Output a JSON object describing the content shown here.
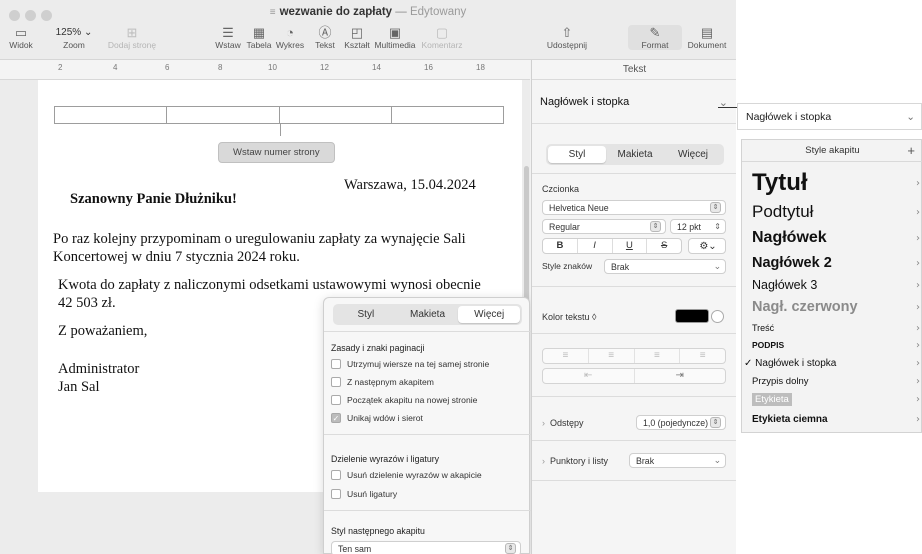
{
  "window": {
    "title": "wezwanie do zapłaty",
    "title_sep": "—",
    "edited": "Edytowany"
  },
  "toolbar": {
    "view": "Widok",
    "zoom_value": "125%",
    "zoom": "Zoom",
    "add_page": "Dodaj stronę",
    "insert": "Wstaw",
    "table": "Tabela",
    "chart": "Wykres",
    "text": "Tekst",
    "shape": "Kształt",
    "media": "Multimedia",
    "comment": "Komentarz",
    "share": "Udostępnij",
    "format": "Format",
    "document": "Dokument"
  },
  "ruler": {
    "marks": [
      "2",
      "4",
      "6",
      "8",
      "10",
      "12",
      "14",
      "16",
      "18"
    ]
  },
  "document": {
    "insert_page_number": "Wstaw numer strony",
    "date": "Warszawa, 15.04.2024",
    "greeting": "Szanowny Panie Dłużniku!",
    "p1_l1": "Po raz kolejny przypominam o uregulowaniu zapłaty za wynajęcie Sali",
    "p1_l2": "Koncertowej w dniu 7 stycznia 2024 roku.",
    "p2_l1": "Kwota do zapłaty z naliczonymi odsetkami ustawowymi wynosi obecnie",
    "p2_l2": "42 503 zł.",
    "closing": "Z poważaniem,",
    "sign_l1": "Administrator",
    "sign_l2": "Jan Sal"
  },
  "popover": {
    "tabs": [
      "Styl",
      "Makieta",
      "Więcej"
    ],
    "section1": "Zasady i znaki paginacji",
    "opt1": "Utrzymuj wiersze na tej samej stronie",
    "opt2": "Z następnym akapitem",
    "opt3": "Początek akapitu na nowej stronie",
    "opt4": "Unikaj wdów i sierot",
    "section2": "Dzielenie wyrazów i ligatury",
    "opt5": "Usuń dzielenie wyrazów w akapicie",
    "opt6": "Usuń ligatury",
    "section3": "Styl następnego akapitu",
    "next_style": "Ten sam"
  },
  "sidebar": {
    "header": "Tekst",
    "style_select": "Nagłówek i stopka",
    "tabs": [
      "Styl",
      "Makieta",
      "Więcej"
    ],
    "font_label": "Czcionka",
    "font_family": "Helvetica Neue",
    "font_style": "Regular",
    "font_size": "12 pkt",
    "bold": "B",
    "italic": "I",
    "underline": "U",
    "strike": "S",
    "char_styles_label": "Style znaków",
    "char_style": "Brak",
    "text_color_label": "Kolor tekstu ◊",
    "spacing_label": "Odstępy",
    "spacing_value": "1,0 (pojedyncze)",
    "bullets_label": "Punktory i listy",
    "bullets_value": "Brak"
  },
  "style_menu": {
    "selected": "Nagłówek i stopka",
    "header": "Style akapitu",
    "add": "+",
    "check": "✓",
    "items": [
      "Tytuł",
      "Podtytuł",
      "Nagłówek",
      "Nagłówek 2",
      "Nagłówek 3",
      "Nagł. czerwony",
      "Treść",
      "PODPIS",
      "Nagłówek i stopka",
      "Przypis dolny",
      "Etykieta",
      "Etykieta ciemna"
    ]
  }
}
